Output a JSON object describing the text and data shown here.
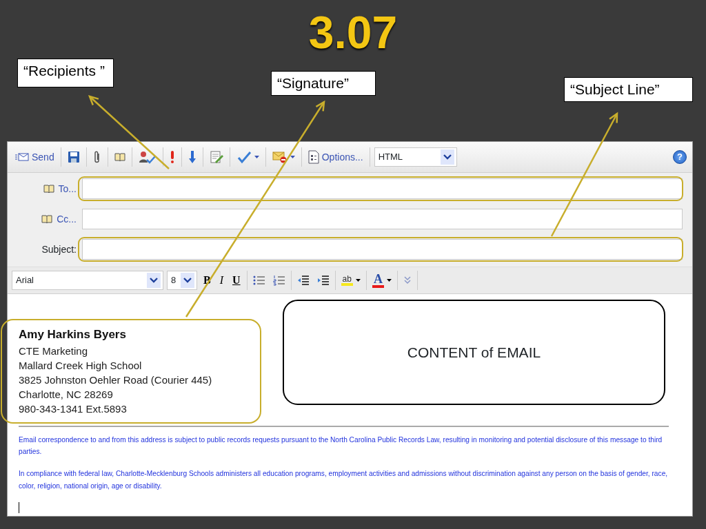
{
  "slide": {
    "title": "3.07"
  },
  "callouts": [
    {
      "text": "“Recipients ”"
    },
    {
      "text": "“Signature”"
    },
    {
      "text": "“Subject Line”"
    }
  ],
  "toolbar": {
    "send": "Send",
    "options": "Options...",
    "format": "HTML",
    "help": "?"
  },
  "fields": [
    {
      "label": "To...",
      "kind": "link",
      "highlighted": true
    },
    {
      "label": "Cc...",
      "kind": "link",
      "highlighted": false
    },
    {
      "label": "Subject:",
      "kind": "plain",
      "highlighted": true
    }
  ],
  "format_bar": {
    "font": "Arial",
    "size": "8",
    "styles": [
      "B",
      "I",
      "U"
    ],
    "highlight": "ab",
    "font_color": "A"
  },
  "signature": {
    "highlighted": true,
    "name": "Amy Harkins Byers",
    "lines": [
      "CTE Marketing",
      "Mallard Creek High School",
      "3825 Johnston Oehler Road (Courier 445)",
      "Charlotte, NC 28269",
      "980-343-1341 Ext.5893"
    ]
  },
  "content_box": "CONTENT of EMAIL",
  "disclaimers": [
    "Email correspondence to and from this address is subject to public records requests pursuant to the North Carolina Public Records Law, resulting in monitoring and potential disclosure of this message to third parties.",
    "In compliance with federal law, Charlotte-Mecklenburg Schools administers all education programs, employment activities and admissions without discrimination against any person on the basis of gender, race, color, religion, national origin, age or disability."
  ]
}
